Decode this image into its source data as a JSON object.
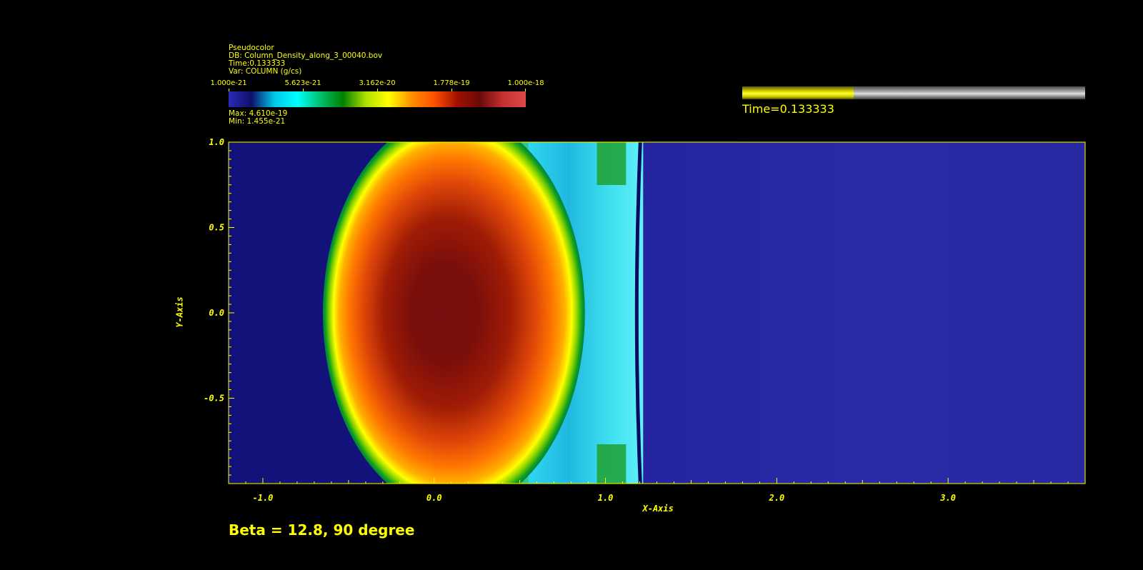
{
  "legend": {
    "plot_type": "Pseudocolor",
    "db": "DB: Column_Density_along_3_00040.bov",
    "time": "Time:0.133333",
    "var": "Var: COLUMN (g/cs)",
    "max": "Max:  4.610e-19",
    "min": "Min:  1.455e-21",
    "tick_labels": [
      "1.000e-21",
      "5.623e-21",
      "3.162e-20",
      "1.778e-19",
      "1.000e-18"
    ],
    "colormap": [
      "#2a2ab8",
      "#10106a",
      "#00c8e8",
      "#00ffff",
      "#00c070",
      "#008000",
      "#b0e000",
      "#ffff00",
      "#ff9000",
      "#ff5000",
      "#a01000",
      "#6a0a0a",
      "#c83030",
      "#dc4848"
    ]
  },
  "time_slider": {
    "label": "Time=0.133333",
    "progress": 0.325,
    "fill_color": "#ffff00",
    "track_color": "#a0a0a0"
  },
  "caption": "Beta = 12.8, 90 degree",
  "chart_data": {
    "type": "heatmap",
    "title": "",
    "xlabel": "X-Axis",
    "ylabel": "Y-Axis",
    "xlim": [
      -1.2,
      3.8
    ],
    "ylim": [
      -1.0,
      1.0
    ],
    "xticks": [
      -1.0,
      0.0,
      1.0,
      2.0,
      3.0
    ],
    "xtick_labels": [
      "-1.0",
      "0.0",
      "1.0",
      "2.0",
      "3.0"
    ],
    "yticks": [
      1.0,
      0.5,
      0.0,
      -0.5
    ],
    "ytick_labels": [
      "1.0",
      "0.5",
      "0.0",
      "-0.5"
    ],
    "color_scale": "log",
    "value_range": [
      1.455e-21,
      4.61e-19
    ],
    "background_color": "#2a2aa0",
    "features": [
      {
        "name": "dense-cloud-core",
        "center": [
          0.0,
          0.0
        ],
        "value": 4.61e-19
      },
      {
        "name": "cloud-left-edge-x",
        "value": -0.65
      },
      {
        "name": "cloud-right-edge-x",
        "value": 0.88
      },
      {
        "name": "shock-front-x",
        "value": 1.22
      }
    ]
  }
}
